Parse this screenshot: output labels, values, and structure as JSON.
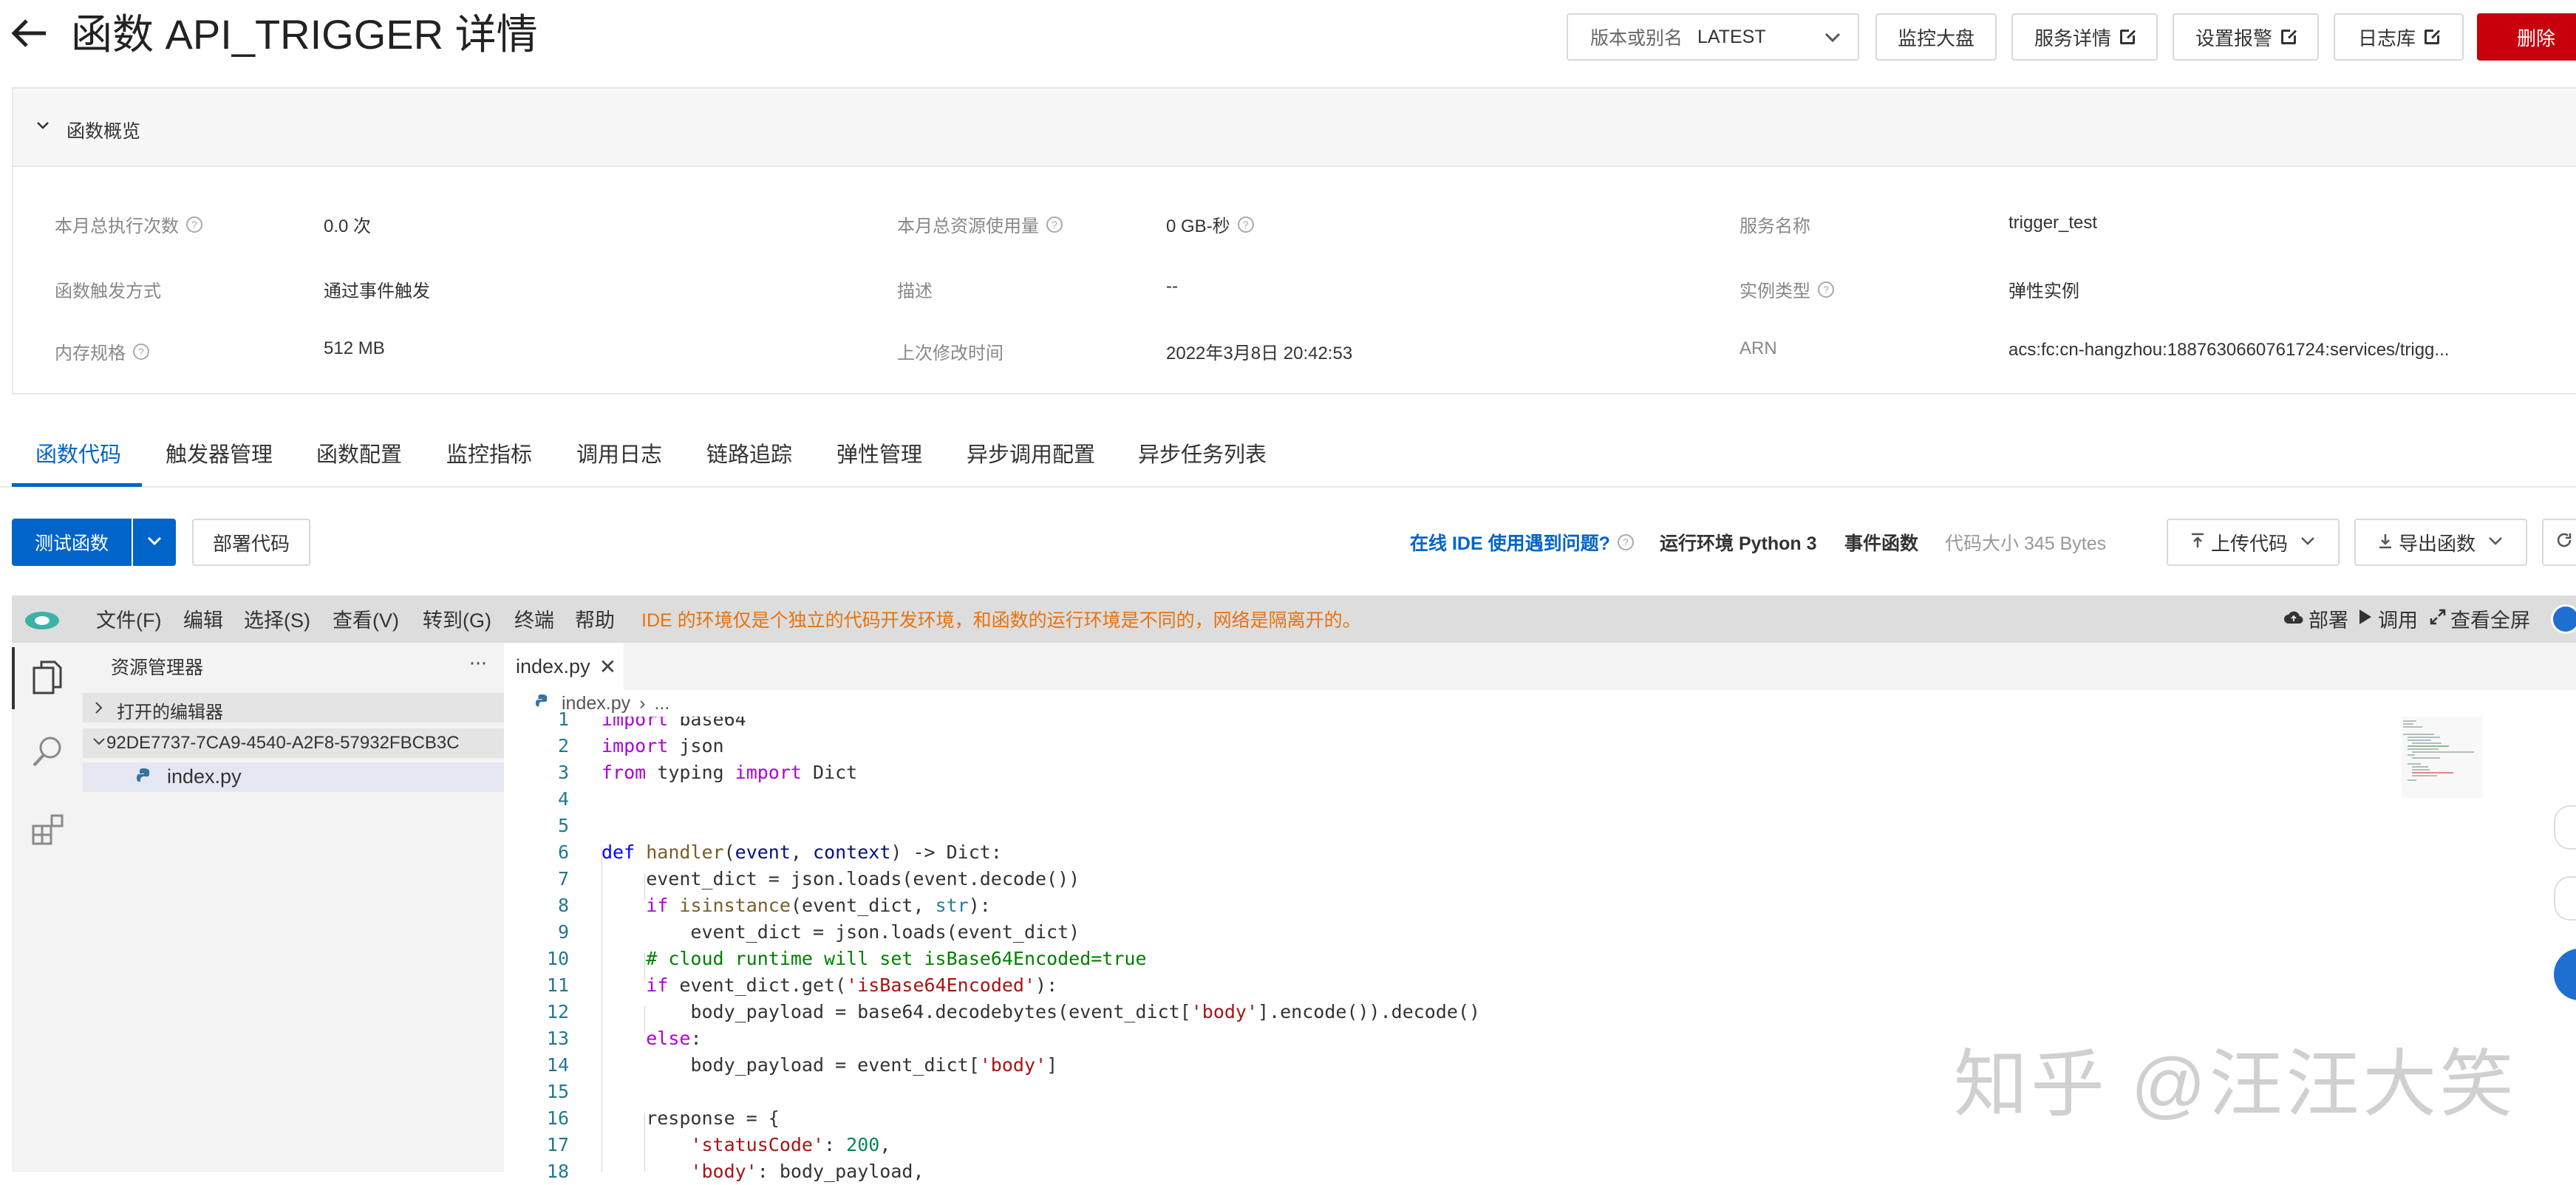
{
  "header": {
    "title": "函数 API_TRIGGER 详情",
    "version_label": "版本或别名",
    "version_value": "LATEST",
    "monitor_label": "监控大盘",
    "service_detail_label": "服务详情",
    "alarm_label": "设置报警",
    "log_label": "日志库",
    "delete_label": "删除"
  },
  "overview": {
    "title": "函数概览",
    "rows": [
      {
        "label": "本月总执行次数",
        "value": "0.0 次"
      },
      {
        "label": "函数触发方式",
        "value": "通过事件触发"
      },
      {
        "label": "内存规格",
        "value": "512 MB"
      }
    ],
    "col2": [
      {
        "label": "本月总资源使用量",
        "value": "0 GB-秒"
      },
      {
        "label": "描述",
        "value": "--"
      },
      {
        "label": "上次修改时间",
        "value": "2022年3月8日 20:42:53"
      }
    ],
    "col3": [
      {
        "label": "服务名称",
        "value": "trigger_test"
      },
      {
        "label": "实例类型",
        "value": "弹性实例"
      },
      {
        "label": "ARN",
        "value": "acs:fc:cn-hangzhou:1887630660761724:services/trigg..."
      }
    ]
  },
  "tabs": [
    "函数代码",
    "触发器管理",
    "函数配置",
    "监控指标",
    "调用日志",
    "链路追踪",
    "弹性管理",
    "异步调用配置",
    "异步任务列表"
  ],
  "toolbar": {
    "test_label": "测试函数",
    "deploy_label": "部署代码",
    "ide_help": "在线 IDE 使用遇到问题?",
    "runtime": "运行环境 Python 3",
    "func_type": "事件函数",
    "code_size": "代码大小 345 Bytes",
    "upload_label": "上传代码",
    "export_label": "导出函数"
  },
  "ide": {
    "menu": [
      "文件(F)",
      "编辑",
      "选择(S)",
      "查看(V)",
      "转到(G)",
      "终端",
      "帮助"
    ],
    "notice": "IDE 的环境仅是个独立的代码开发环境，和函数的运行环境是不同的，网络是隔离开的。",
    "deploy": "部署",
    "debug": "调用",
    "fullscreen": "查看全屏",
    "explorer_title": "资源管理器",
    "open_editors": "打开的编辑器",
    "folder": "92DE7737-7CA9-4540-A2F8-57932FBCB3C",
    "file": "index.py",
    "tab_file": "index.py",
    "breadcrumb_file": "index.py",
    "breadcrumb_rest": "...",
    "watermark": "知乎 @汪汪大笑",
    "line_numbers": [
      "1",
      "2",
      "3",
      "4",
      "5",
      "6",
      "7",
      "8",
      "9",
      "10",
      "11",
      "12",
      "13",
      "14",
      "15",
      "16",
      "17",
      "18"
    ]
  }
}
